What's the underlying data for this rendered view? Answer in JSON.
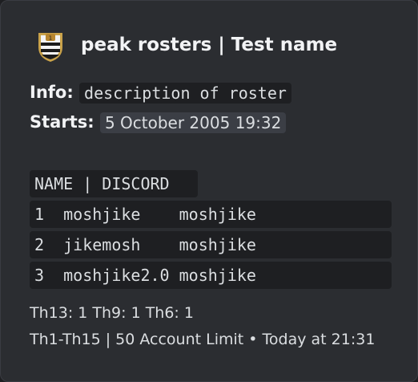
{
  "embed": {
    "accent_color": "#2b2d31",
    "author": {
      "icon": "striped-shield-badge-icon",
      "name": "peak rosters | Test name"
    },
    "info": {
      "label": "Info:",
      "value": "description of roster"
    },
    "starts": {
      "label": "Starts:",
      "value": "5 October 2005 19:32"
    },
    "roster": {
      "header": "NAME | DISCORD",
      "rows": [
        "1  moshjike    moshjike",
        "2  jikemosh    moshjike",
        "3  moshjike2.0 moshjike"
      ]
    },
    "townhall_counts": "Th13: 1 Th9: 1 Th6: 1",
    "footer": {
      "text": "Th1-Th15 | 50 Account Limit",
      "separator": "•",
      "time": "Today at 21:31"
    }
  }
}
